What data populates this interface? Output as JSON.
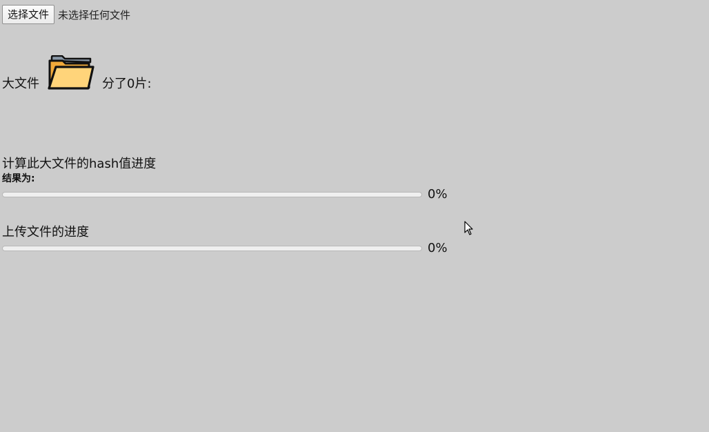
{
  "file_input": {
    "button_label": "选择文件",
    "status_text": "未选择任何文件"
  },
  "big_file": {
    "label": "大文件",
    "icon": "folder-icon",
    "chunks_text": "分了0片:"
  },
  "hash": {
    "title": "计算此大文件的hash值进度",
    "result_label": "结果为:",
    "progress_percent": 0,
    "progress_text": "0%"
  },
  "upload": {
    "title": "上传文件的进度",
    "progress_percent": 0,
    "progress_text": "0%"
  },
  "colors": {
    "background": "#cccccc",
    "folder_fill": "#ffd47a",
    "progress_fill": "#3b82f6"
  }
}
